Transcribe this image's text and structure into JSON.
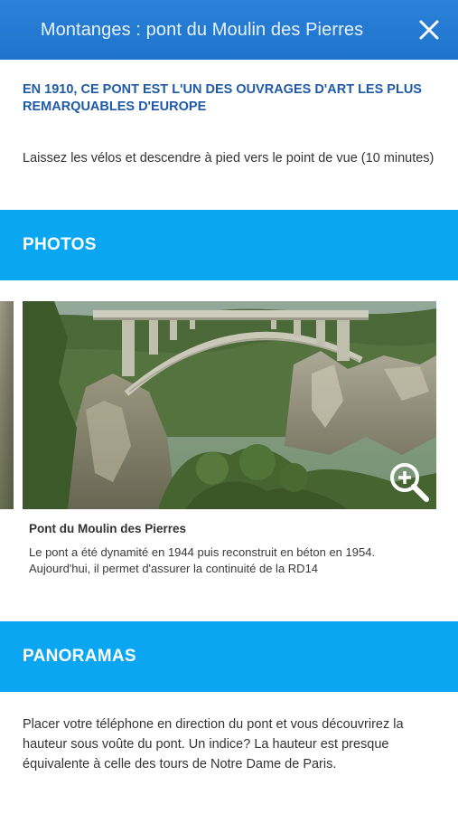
{
  "header": {
    "title": "Montanges : pont du Moulin des Pierres",
    "close_icon": "close-icon"
  },
  "content": {
    "headline": "EN 1910, CE PONT EST L'UN DES OUVRAGES D'ART LES PLUS REMARQUABLES D'EUROPE",
    "intro": "Laissez les vélos et descendre à pied vers le point de vue (10 minutes)"
  },
  "photos_section": {
    "title": "PHOTOS",
    "items": [
      {
        "caption_title": "Pont du Moulin des Pierres",
        "caption_text": "Le pont a été dynamité en 1944 puis reconstruit en béton en 1954. Aujourd'hui, il permet d'assurer la continuité de la RD14",
        "zoom_icon": "zoom-in-icon"
      }
    ]
  },
  "panoramas_section": {
    "title": "PANORAMAS",
    "text": "Placer votre téléphone en direction du pont et vous découvrirez la hauteur sous voûte du pont. Un indice? La hauteur est presque équivalente à celle des tours de Notre Dame de Paris."
  },
  "colors": {
    "header_bg": "#1f73cc",
    "section_band": "#0aa6f2",
    "headline": "#1e5aa8"
  }
}
